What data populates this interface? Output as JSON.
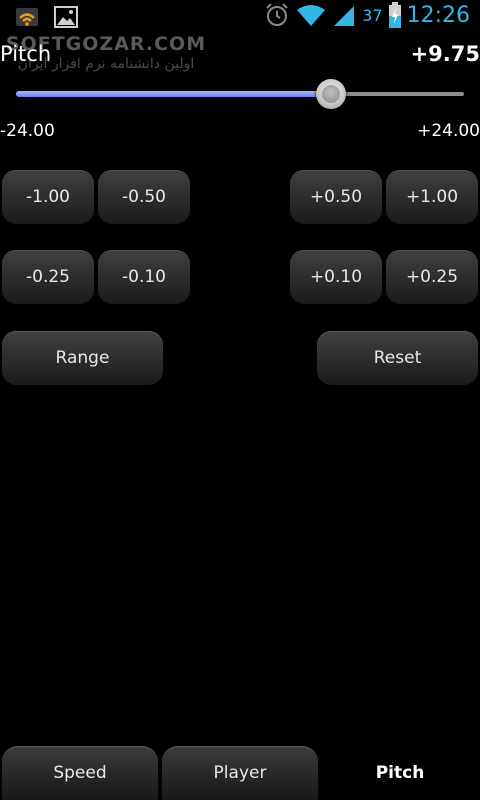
{
  "status_bar": {
    "icons_left": [
      "wifi-notification-icon",
      "image-icon"
    ],
    "icons_right": [
      "alarm-icon",
      "wifi-signal-icon",
      "cell-signal-icon",
      "battery-charging-icon"
    ],
    "battery": "37",
    "time": "12:26",
    "accent_color": "#33b5e5"
  },
  "watermark": {
    "brand": "SOFTGOZAR.COM",
    "subtitle": "اولین دانشنامه نرم افزار ایران"
  },
  "header": {
    "title": "Pitch",
    "value": "+9.75"
  },
  "slider": {
    "min": -24.0,
    "max": 24.0,
    "value": 9.75,
    "min_label": "-24.00",
    "max_label": "+24.00"
  },
  "buttons": {
    "minus_1": "-1.00",
    "minus_050": "-0.50",
    "plus_050": "+0.50",
    "plus_1": "+1.00",
    "minus_025": "-0.25",
    "minus_010": "-0.10",
    "plus_010": "+0.10",
    "plus_025": "+0.25",
    "range": "Range",
    "reset": "Reset"
  },
  "tabs": [
    {
      "label": "Speed",
      "active": false
    },
    {
      "label": "Player",
      "active": false
    },
    {
      "label": "Pitch",
      "active": true
    }
  ]
}
